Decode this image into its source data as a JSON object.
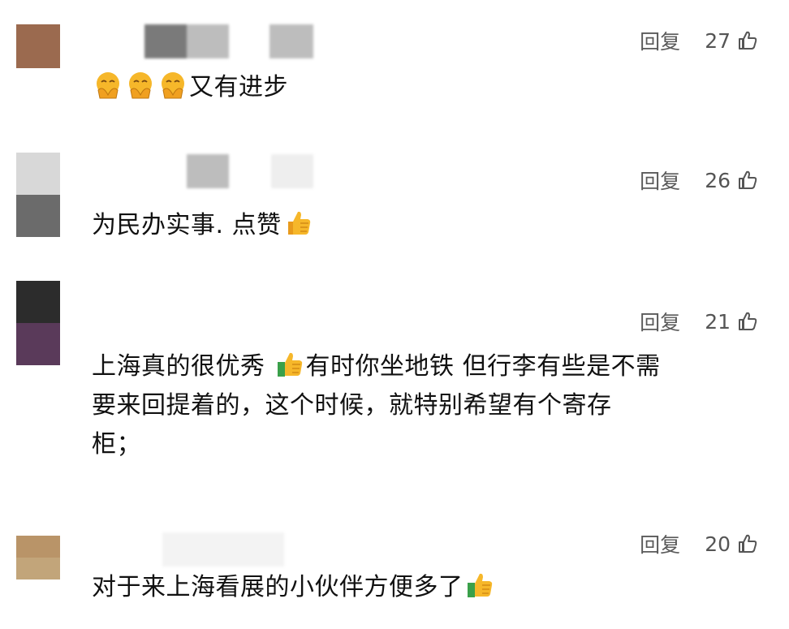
{
  "comments": [
    {
      "text_before": "",
      "emojis_before": [
        "pray-face-emoji",
        "pray-face-emoji",
        "pray-face-emoji"
      ],
      "text": "又有进步",
      "reply": "回复",
      "likes": "27",
      "avatar_colors": [
        "#9b6a4f",
        "#9b6a4f"
      ]
    },
    {
      "text": "为民办实事. 点赞",
      "reply": "回复",
      "likes": "26",
      "avatar_colors": [
        "#d8d8d8",
        "#6b6b6b"
      ]
    },
    {
      "text_a": "上海真的很优秀",
      "text_b": "有时你坐地铁 但行李有些是不需",
      "text_c": "要来回提着的，这个时候，就特别希望有个寄存",
      "text_d": "柜；",
      "reply": "回复",
      "likes": "21",
      "avatar_colors": [
        "#2c2c2c",
        "#5a3a5a"
      ]
    },
    {
      "text": "对于来上海看展的小伙伴方便多了",
      "reply": "回复",
      "likes": "20",
      "avatar_colors": [
        "#b99468",
        "#c2a57a"
      ]
    }
  ],
  "colors": {
    "meta_text": "#555555",
    "body_text": "#111111",
    "emoji_yellow": "#f6b72a",
    "emoji_green": "#3aa04a"
  }
}
